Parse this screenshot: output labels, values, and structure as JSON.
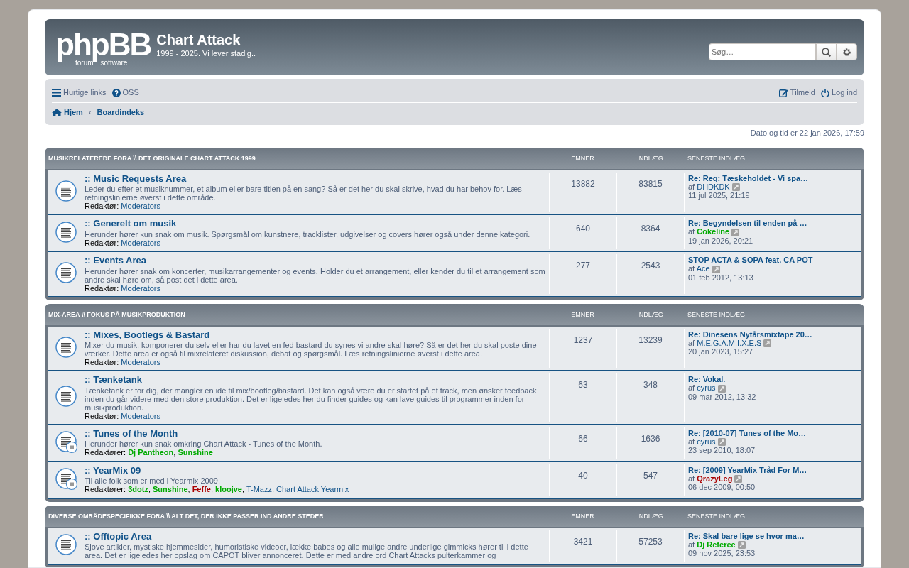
{
  "header": {
    "logo": {
      "mark": "phpBB",
      "sub_left": "forum",
      "sub_right": "software"
    },
    "site_title": "Chart Attack",
    "site_description": "1999 - 2025. Vi lever stadig.."
  },
  "search": {
    "placeholder": "Søg…"
  },
  "quick_links": [
    {
      "label": "Hurtige links"
    },
    {
      "label": "OSS"
    }
  ],
  "user_links": [
    {
      "label": "Tilmeld"
    },
    {
      "label": "Log ind"
    }
  ],
  "breadcrumbs": [
    {
      "label": "Hjem"
    },
    {
      "label": "Boardindeks"
    }
  ],
  "breadcrumb_separator": "‹",
  "datetime": "Dato og tid er 22 jan 2026, 17:59",
  "categories": [
    {
      "title": "MUSIKRELATEREDE FORA \\\\ DET ORIGINALE CHART ATTACK 1999",
      "columns": [
        "EMNER",
        "INDLÆG",
        "SENESTE INDLÆG"
      ],
      "forums": [
        {
          "kind": "forum",
          "title": ":: Music Requests Area",
          "description": "Leder du efter et musiknummer, et album eller bare titlen på en sang? Så er det her du skal skrive, hvad du har behov for. Læs retningslinierne øverst i dette område.",
          "moderators_label": "Redaktør:",
          "moderators": [
            {
              "name": "Moderators",
              "color": "#105289",
              "bold": false
            }
          ],
          "topics": "13882",
          "posts": "83815",
          "last_post": {
            "title": "Re: Req: Tæskeholdet - Vi spa…",
            "by_label": "af",
            "author": {
              "name": "DHDKDK",
              "color": "#105289",
              "bold": false
            },
            "time": "11 jul 2025, 21:19"
          }
        },
        {
          "kind": "forum",
          "title": ":: Generelt om musik",
          "description": "Herunder hører kun snak om musik. Spørgsmål om kunstnere, tracklister, udgivelser og covers hører også under denne kategori.",
          "moderators_label": "Redaktør:",
          "moderators": [
            {
              "name": "Moderators",
              "color": "#105289",
              "bold": false
            }
          ],
          "topics": "640",
          "posts": "8364",
          "last_post": {
            "title": "Re: Begyndelsen til enden på …",
            "by_label": "af",
            "author": {
              "name": "Cokeline",
              "color": "#00aa00",
              "bold": true
            },
            "time": "19 jan 2026, 20:21"
          }
        },
        {
          "kind": "forum",
          "title": ":: Events Area",
          "description": "Herunder hører snak om koncerter, musikarrangementer og events. Holder du et arrangement, eller kender du til et arrangement som andre skal høre om, så post det i dette area.",
          "moderators_label": "Redaktør:",
          "moderators": [
            {
              "name": "Moderators",
              "color": "#105289",
              "bold": false
            }
          ],
          "topics": "277",
          "posts": "2543",
          "last_post": {
            "title": "STOP ACTA & SOPA feat. CA POT",
            "by_label": "af",
            "author": {
              "name": "Ace",
              "color": "#105289",
              "bold": false
            },
            "time": "01 feb 2012, 13:13"
          }
        }
      ]
    },
    {
      "title": "MIX-AREA \\\\ FOKUS PÅ MUSIKPRODUKTION",
      "columns": [
        "EMNER",
        "INDLÆG",
        "SENESTE INDLÆG"
      ],
      "forums": [
        {
          "kind": "forum",
          "title": ":: Mixes, Bootlegs & Bastard",
          "description": "Mixer du musik, komponerer du selv eller har du lavet en fed bastard du synes vi andre skal høre? Så er det her du skal poste dine værker. Dette area er også til mixrelateret diskussion, debat og spørgsmål. Læs retningslinierne øverst i dette area.",
          "moderators_label": "Redaktør:",
          "moderators": [
            {
              "name": "Moderators",
              "color": "#105289",
              "bold": false
            }
          ],
          "topics": "1237",
          "posts": "13239",
          "last_post": {
            "title": "Re: Dinesens Nytårsmixtape 20…",
            "by_label": "af",
            "author": {
              "name": "M.E.G.A.M.I.X.E.S",
              "color": "#105289",
              "bold": false
            },
            "time": "20 jan 2023, 15:27"
          }
        },
        {
          "kind": "forum",
          "title": ":: Tænketank",
          "description": "Tænketank er for dig, der mangler en idé til mix/bootleg/bastard. Det kan også være du er startet på et track, men ønsker feedback inden du går videre med den store produktion. Det er ligeledes her du finder guides og kan lave guides til programmer inden for musikproduktion.",
          "moderators_label": "Redaktør:",
          "moderators": [
            {
              "name": "Moderators",
              "color": "#105289",
              "bold": false
            }
          ],
          "topics": "63",
          "posts": "348",
          "last_post": {
            "title": "Re: Vokal.",
            "by_label": "af",
            "author": {
              "name": "cyrus",
              "color": "#105289",
              "bold": false
            },
            "time": "09 mar 2012, 13:32"
          }
        },
        {
          "kind": "subforum",
          "title": ":: Tunes of the Month",
          "description": "Herunder hører kun snak omkring Chart Attack - Tunes of the Month.",
          "moderators_label": "Redaktører:",
          "moderators": [
            {
              "name": "Dj Pantheon",
              "after": ",",
              "color": "#00aa00",
              "bold": true
            },
            {
              "name": "Sunshine",
              "color": "#00aa00",
              "bold": true
            }
          ],
          "topics": "66",
          "posts": "1636",
          "last_post": {
            "title": "Re: [2010-07] Tunes of the Mo…",
            "by_label": "af",
            "author": {
              "name": "cyrus",
              "color": "#105289",
              "bold": false
            },
            "time": "23 sep 2010, 18:07"
          }
        },
        {
          "kind": "subforum",
          "title": ":: YearMix 09",
          "description": "Til alle folk som er med i Yearmix 2009.",
          "moderators_label": "Redaktører:",
          "moderators": [
            {
              "name": "3dotz",
              "after": ",",
              "color": "#00aa00",
              "bold": true
            },
            {
              "name": "Sunshine",
              "after": ",",
              "color": "#00aa00",
              "bold": true
            },
            {
              "name": "Feffe",
              "after": ",",
              "color": "#aa0000",
              "bold": true
            },
            {
              "name": "kloojve",
              "after": ",",
              "color": "#00aa00",
              "bold": true
            },
            {
              "name": "T-Mazz",
              "after": ",",
              "color": "#105289",
              "bold": false
            },
            {
              "name": "Chart Attack Yearmix",
              "color": "#105289",
              "bold": false
            }
          ],
          "topics": "40",
          "posts": "547",
          "last_post": {
            "title": "Re: [2009] YearMix Tråd For M…",
            "by_label": "af",
            "author": {
              "name": "QrazyLeg",
              "color": "#aa0000",
              "bold": true
            },
            "time": "06 dec 2009, 00:50"
          }
        }
      ]
    },
    {
      "title": "DIVERSE OMRÅDESPECIFIKKE FORA \\\\ ALT DET, DER IKKE PASSER IND ANDRE STEDER",
      "columns": [
        "EMNER",
        "INDLÆG",
        "SENESTE INDLÆG"
      ],
      "forums": [
        {
          "kind": "forum",
          "title": ":: Offtopic Area",
          "description": "Sjove artikler, mystiske hjemmesider, humoristiske videoer, lække babes og alle mulige andre underlige gimmicks hører til i dette area. Det er ligeledes her opslag om CAPOT bliver annonceret. Dette er med andre ord Chart Attacks pulterkammer og",
          "topics": "3421",
          "posts": "57253",
          "last_post": {
            "title": "Re: Skal bare lige se hvor ma…",
            "by_label": "af",
            "author": {
              "name": "Dj Referee",
              "color": "#00aa00",
              "bold": true
            },
            "time": "09 nov 2025, 23:53"
          }
        }
      ]
    }
  ]
}
